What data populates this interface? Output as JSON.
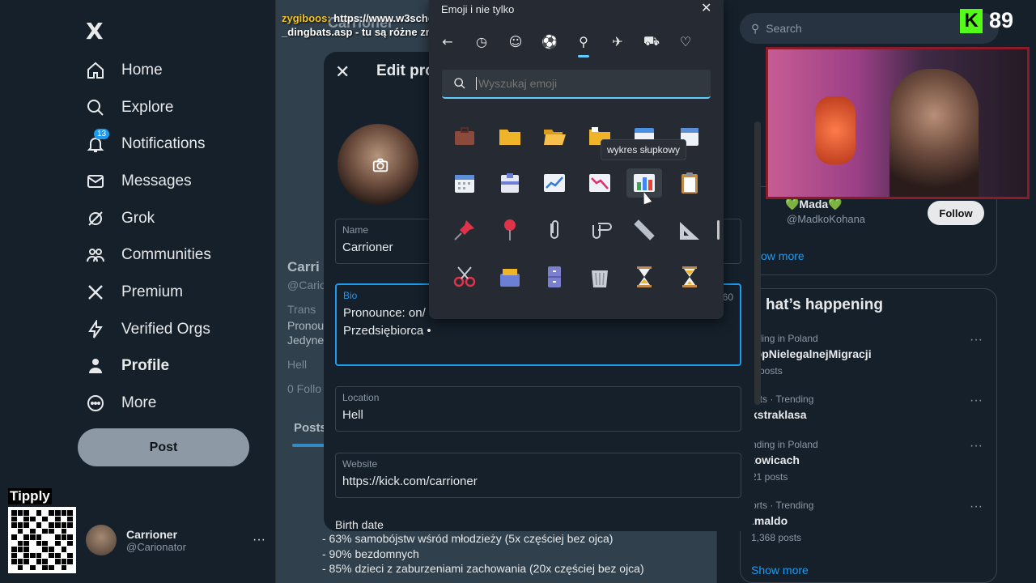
{
  "sidebar": {
    "logo": "X",
    "nav": [
      {
        "label": "Home",
        "icon": "home-icon"
      },
      {
        "label": "Explore",
        "icon": "search-icon"
      },
      {
        "label": "Notifications",
        "icon": "bell-icon",
        "badge": "13"
      },
      {
        "label": "Messages",
        "icon": "envelope-icon"
      },
      {
        "label": "Grok",
        "icon": "grok-icon"
      },
      {
        "label": "Communities",
        "icon": "people-icon"
      },
      {
        "label": "Premium",
        "icon": "x-icon"
      },
      {
        "label": "Verified Orgs",
        "icon": "lightning-icon"
      },
      {
        "label": "Profile",
        "icon": "person-icon"
      },
      {
        "label": "More",
        "icon": "more-circle-icon"
      }
    ],
    "post_label": "Post",
    "account": {
      "name": "Carrioner",
      "handle": "@Carionator"
    }
  },
  "tippy": {
    "label": "Tipply"
  },
  "chat": {
    "user": "zygiboos:",
    "message_line1": "https://www.w3schools.com/charsets/ref_utf",
    "message_line2": "_dingbats.asp - tu są różne znaki"
  },
  "top_name": "Carrioner",
  "middle": {
    "profile_name": "Carri",
    "handle": "@Cario",
    "trans": "Trans",
    "bio1": "Pronou",
    "bio2": "Jedyne",
    "location": "Hell",
    "follows": "0 Follo",
    "tab": "Posts"
  },
  "modal": {
    "title": "Edit pro",
    "fields": {
      "name_label": "Name",
      "name_value": "Carrioner",
      "bio_label": "Bio",
      "bio_line1": "Pronounce: on/",
      "bio_line2": "Przedsiębiorca •",
      "bio_counter": "60",
      "location_label": "Location",
      "location_value": "Hell",
      "website_label": "Website",
      "website_value": "https://kick.com/carrioner"
    },
    "birth_label": "Birth date"
  },
  "bottom_lines": [
    "- 63% samobójstw wśród młodzieży  (5x częściej bez ojca)",
    "- 90% bezdomnych",
    "- 85% dzieci z zaburzeniami zachowania (20x częściej bez ojca)"
  ],
  "picker": {
    "title": "Emoji i nie tylko",
    "search_placeholder": "Wyszukaj emoji",
    "tooltip": "wykres słupkowy",
    "tabs": [
      "back-icon",
      "clock-icon",
      "smiley-icon",
      "ball-icon",
      "pin-icon",
      "plane-icon",
      "car-icon",
      "heart-icon"
    ],
    "emojis": [
      "briefcase",
      "folder",
      "open-folder",
      "folder-divider",
      "calendar-tearoff",
      "spiral-calendar",
      "calendar",
      "card-index",
      "chart-increasing",
      "chart-decreasing",
      "bar-chart",
      "clipboard",
      "pushpin",
      "round-pushpin",
      "paperclip",
      "linked-paperclips",
      "straight-ruler",
      "triangular-ruler",
      "scissors",
      "card-file-box",
      "file-cabinet",
      "wastebasket",
      "hourglass-done",
      "hourglass-flowing"
    ]
  },
  "right": {
    "search_placeholder": "Search",
    "kick_count": "89",
    "follow_name": "💚Mada💚",
    "follow_handle": "@MadkoKohana",
    "follow_label": "Follow",
    "show_more_top": "ow more",
    "trends_title": "hat’s happening",
    "trends": [
      {
        "meta": "nding in Poland",
        "tag": "topNielegalnejMigracji",
        "count": "6 posts"
      },
      {
        "meta": "orts · Trending",
        "tag": "kstraklasa",
        "count": ""
      },
      {
        "meta": "nding in Poland",
        "tag": "towicach",
        "count": "21 posts"
      },
      {
        "meta": "orts · Trending",
        "tag": "imaldo",
        "count": "1,368 posts"
      }
    ],
    "show_more": "Show more"
  },
  "colors": {
    "accent": "#1d9bf0",
    "bg": "#15202b",
    "picker_accent": "#60cdff"
  }
}
